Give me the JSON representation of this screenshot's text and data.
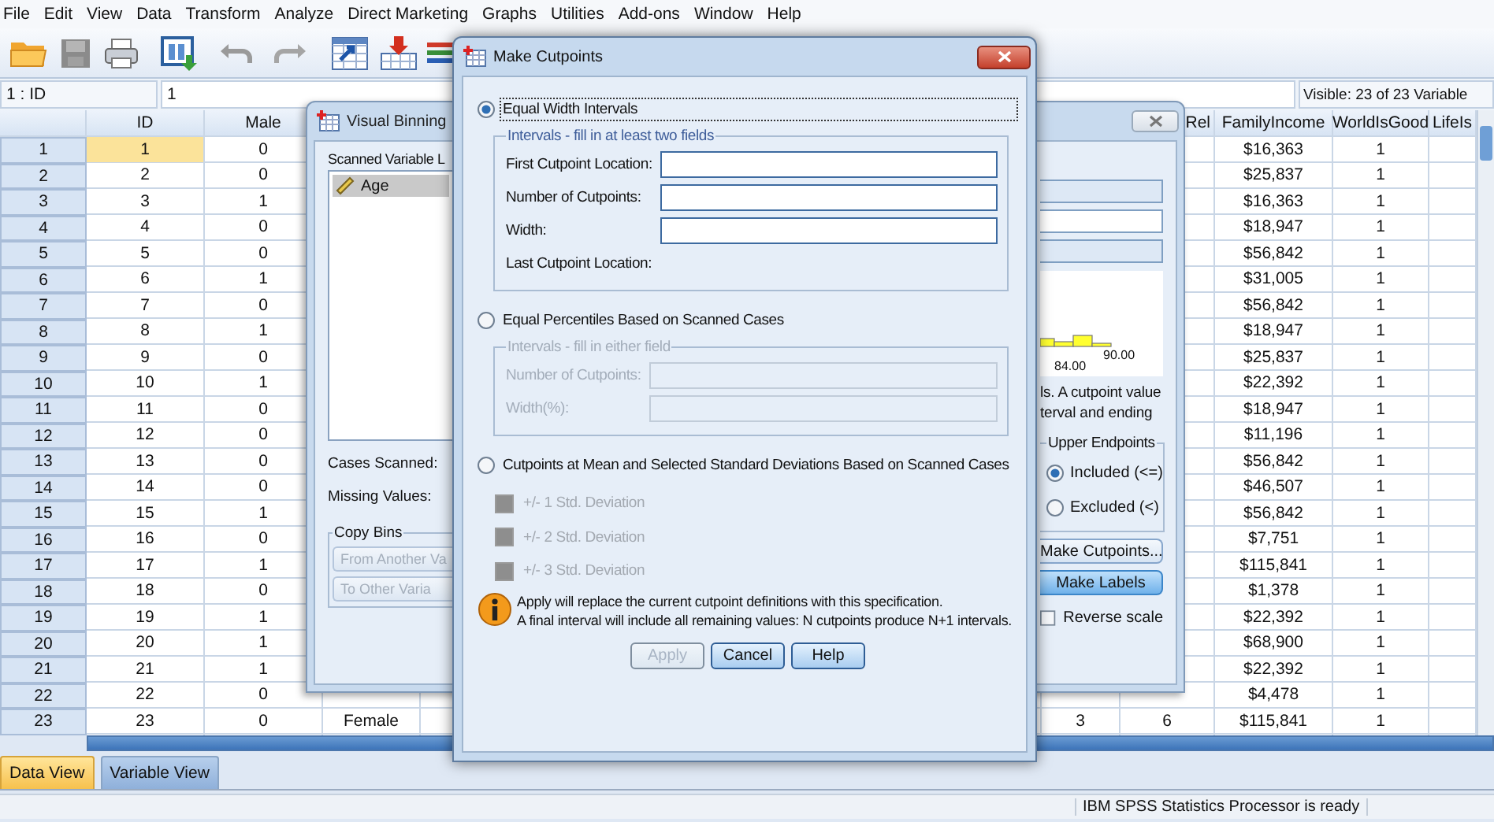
{
  "menu": [
    "File",
    "Edit",
    "View",
    "Data",
    "Transform",
    "Analyze",
    "Direct Marketing",
    "Graphs",
    "Utilities",
    "Add-ons",
    "Window",
    "Help"
  ],
  "cell_reference": {
    "name": "1 : ID",
    "value": "1"
  },
  "variables_visible": "Visible: 23 of 23 Variable",
  "grid": {
    "columns": [
      "ID",
      "Male",
      null,
      null,
      "Rel",
      "FamilyIncome",
      "WorldIsGood",
      "LifeIs"
    ],
    "rows": [
      {
        "number": "1",
        "cells": [
          {
            "text": "1",
            "active": true
          },
          {
            "text": "0",
            "active": false
          },
          null,
          null,
          null,
          {
            "text": "$16,363",
            "active": false
          },
          {
            "text": "1",
            "active": false
          },
          null
        ]
      },
      {
        "number": "2",
        "cells": [
          {
            "text": "2",
            "active": false
          },
          {
            "text": "0",
            "active": false
          },
          null,
          null,
          null,
          {
            "text": "$25,837",
            "active": false
          },
          {
            "text": "1",
            "active": false
          },
          null
        ]
      },
      {
        "number": "3",
        "cells": [
          {
            "text": "3",
            "active": false
          },
          {
            "text": "1",
            "active": false
          },
          null,
          null,
          null,
          {
            "text": "$16,363",
            "active": false
          },
          {
            "text": "1",
            "active": false
          },
          null
        ]
      },
      {
        "number": "4",
        "cells": [
          {
            "text": "4",
            "active": false
          },
          {
            "text": "0",
            "active": false
          },
          null,
          null,
          null,
          {
            "text": "$18,947",
            "active": false
          },
          {
            "text": "1",
            "active": false
          },
          null
        ]
      },
      {
        "number": "5",
        "cells": [
          {
            "text": "5",
            "active": false
          },
          {
            "text": "0",
            "active": false
          },
          null,
          null,
          null,
          {
            "text": "$56,842",
            "active": false
          },
          {
            "text": "1",
            "active": false
          },
          null
        ]
      },
      {
        "number": "6",
        "cells": [
          {
            "text": "6",
            "active": false
          },
          {
            "text": "1",
            "active": false
          },
          null,
          null,
          null,
          {
            "text": "$31,005",
            "active": false
          },
          {
            "text": "1",
            "active": false
          },
          null
        ]
      },
      {
        "number": "7",
        "cells": [
          {
            "text": "7",
            "active": false
          },
          {
            "text": "0",
            "active": false
          },
          null,
          null,
          null,
          {
            "text": "$56,842",
            "active": false
          },
          {
            "text": "1",
            "active": false
          },
          null
        ]
      },
      {
        "number": "8",
        "cells": [
          {
            "text": "8",
            "active": false
          },
          {
            "text": "1",
            "active": false
          },
          null,
          null,
          null,
          {
            "text": "$18,947",
            "active": false
          },
          {
            "text": "1",
            "active": false
          },
          null
        ]
      },
      {
        "number": "9",
        "cells": [
          {
            "text": "9",
            "active": false
          },
          {
            "text": "0",
            "active": false
          },
          null,
          null,
          null,
          {
            "text": "$25,837",
            "active": false
          },
          {
            "text": "1",
            "active": false
          },
          null
        ]
      },
      {
        "number": "10",
        "cells": [
          {
            "text": "10",
            "active": false
          },
          {
            "text": "1",
            "active": false
          },
          null,
          null,
          null,
          {
            "text": "$22,392",
            "active": false
          },
          {
            "text": "1",
            "active": false
          },
          null
        ]
      },
      {
        "number": "11",
        "cells": [
          {
            "text": "11",
            "active": false
          },
          {
            "text": "0",
            "active": false
          },
          null,
          null,
          null,
          {
            "text": "$18,947",
            "active": false
          },
          {
            "text": "1",
            "active": false
          },
          null
        ]
      },
      {
        "number": "12",
        "cells": [
          {
            "text": "12",
            "active": false
          },
          {
            "text": "0",
            "active": false
          },
          null,
          null,
          null,
          {
            "text": "$11,196",
            "active": false
          },
          {
            "text": "1",
            "active": false
          },
          null
        ]
      },
      {
        "number": "13",
        "cells": [
          {
            "text": "13",
            "active": false
          },
          {
            "text": "0",
            "active": false
          },
          null,
          null,
          null,
          {
            "text": "$56,842",
            "active": false
          },
          {
            "text": "1",
            "active": false
          },
          null
        ]
      },
      {
        "number": "14",
        "cells": [
          {
            "text": "14",
            "active": false
          },
          {
            "text": "0",
            "active": false
          },
          null,
          null,
          null,
          {
            "text": "$46,507",
            "active": false
          },
          {
            "text": "1",
            "active": false
          },
          null
        ]
      },
      {
        "number": "15",
        "cells": [
          {
            "text": "15",
            "active": false
          },
          {
            "text": "1",
            "active": false
          },
          null,
          null,
          null,
          {
            "text": "$56,842",
            "active": false
          },
          {
            "text": "1",
            "active": false
          },
          null
        ]
      },
      {
        "number": "16",
        "cells": [
          {
            "text": "16",
            "active": false
          },
          {
            "text": "0",
            "active": false
          },
          null,
          null,
          null,
          {
            "text": "$7,751",
            "active": false
          },
          {
            "text": "1",
            "active": false
          },
          null
        ]
      },
      {
        "number": "17",
        "cells": [
          {
            "text": "17",
            "active": false
          },
          {
            "text": "1",
            "active": false
          },
          null,
          null,
          null,
          {
            "text": "$115,841",
            "active": false
          },
          {
            "text": "1",
            "active": false
          },
          null
        ]
      },
      {
        "number": "18",
        "cells": [
          {
            "text": "18",
            "active": false
          },
          {
            "text": "0",
            "active": false
          },
          null,
          null,
          null,
          {
            "text": "$1,378",
            "active": false
          },
          {
            "text": "1",
            "active": false
          },
          null
        ]
      },
      {
        "number": "19",
        "cells": [
          {
            "text": "19",
            "active": false
          },
          {
            "text": "1",
            "active": false
          },
          null,
          null,
          null,
          {
            "text": "$22,392",
            "active": false
          },
          {
            "text": "1",
            "active": false
          },
          null
        ]
      },
      {
        "number": "20",
        "cells": [
          {
            "text": "20",
            "active": false
          },
          {
            "text": "1",
            "active": false
          },
          null,
          null,
          null,
          {
            "text": "$68,900",
            "active": false
          },
          {
            "text": "1",
            "active": false
          },
          null
        ]
      },
      {
        "number": "21",
        "cells": [
          {
            "text": "21",
            "active": false
          },
          {
            "text": "1",
            "active": false
          },
          null,
          null,
          null,
          {
            "text": "$22,392",
            "active": false
          },
          {
            "text": "1",
            "active": false
          },
          null
        ]
      },
      {
        "number": "22",
        "cells": [
          {
            "text": "22",
            "active": false
          },
          {
            "text": "0",
            "active": false
          },
          null,
          null,
          null,
          {
            "text": "$4,478",
            "active": false
          },
          {
            "text": "1",
            "active": false
          },
          null
        ]
      },
      {
        "number": "23",
        "cells": [
          {
            "text": "23",
            "active": false
          },
          {
            "text": "0",
            "active": false
          },
          {
            "text": "Female",
            "active": false
          },
          {
            "text": "3",
            "active": false
          },
          {
            "text": "6",
            "active": false
          },
          {
            "text": "$115,841",
            "active": false
          },
          {
            "text": "1",
            "active": false
          },
          null
        ]
      }
    ]
  },
  "view_tabs": [
    {
      "label": "Data View",
      "selected": true
    },
    {
      "label": "Variable View",
      "selected": false
    }
  ],
  "status_bar": {
    "message": "IBM SPSS Statistics Processor is ready"
  },
  "visual_binning": {
    "title": "Visual Binning",
    "scanned_variable_list_label": "Scanned Variable L",
    "variables": [
      {
        "name": "Age",
        "selected": true
      }
    ],
    "cases_scanned_label": "Cases Scanned:",
    "missing_values_label": "Missing Values:",
    "copy_bins": {
      "title": "Copy Bins",
      "buttons": [
        {
          "label": "From Another Va",
          "disabled": true
        },
        {
          "label": "To Other Varia",
          "disabled": true
        }
      ]
    },
    "fields": [
      {
        "disabled": true
      },
      {
        "disabled": false
      },
      {
        "disabled": true
      }
    ],
    "histogram": {
      "labels": [
        "84.00",
        "90.00"
      ]
    },
    "note_lines": [
      "ls. A cutpoint value",
      "terval and ending"
    ],
    "upper_endpoints": {
      "title": "Upper Endpoints",
      "options": [
        {
          "label": "Included (<=)",
          "selected": true
        },
        {
          "label": "Excluded (<)",
          "selected": false
        }
      ]
    },
    "buttons": [
      {
        "label": "Make Cutpoints...",
        "highlighted": false
      },
      {
        "label": "Make Labels",
        "highlighted": true
      }
    ],
    "reverse_scale": {
      "label": "Reverse scale",
      "checked": false
    }
  },
  "make_cutpoints": {
    "title": "Make Cutpoints",
    "methods": [
      {
        "label": "Equal Width Intervals",
        "selected": true,
        "focused": true,
        "group": {
          "title": "Intervals - fill in at least two fields",
          "disabled": false,
          "fields": [
            {
              "label": "First Cutpoint Location:",
              "kind": "input"
            },
            {
              "label": "Number of Cutpoints:",
              "kind": "input"
            },
            {
              "label": "Width:",
              "kind": "input"
            },
            {
              "label": "Last Cutpoint Location:",
              "kind": "readout"
            }
          ]
        }
      },
      {
        "label": "Equal Percentiles Based on Scanned Cases",
        "selected": false,
        "focused": false,
        "group": {
          "title": "Intervals - fill in either field",
          "disabled": true,
          "fields": [
            {
              "label": "Number of Cutpoints:",
              "kind": "input"
            },
            {
              "label": "Width(%):",
              "kind": "input"
            }
          ]
        }
      },
      {
        "label": "Cutpoints at Mean and Selected Standard Deviations Based on Scanned Cases",
        "selected": false,
        "focused": false,
        "options": [
          {
            "label": "+/- 1 Std. Deviation",
            "checked": false,
            "disabled": true
          },
          {
            "label": "+/- 2 Std. Deviation",
            "checked": false,
            "disabled": true
          },
          {
            "label": "+/- 3 Std. Deviation",
            "checked": false,
            "disabled": true
          }
        ]
      }
    ],
    "info": [
      "Apply will replace the current cutpoint definitions with this specification.",
      "A final interval will include all remaining values: N cutpoints produce N+1 intervals."
    ],
    "buttons": [
      {
        "label": "Apply",
        "disabled": true
      },
      {
        "label": "Cancel",
        "disabled": false
      },
      {
        "label": "Help",
        "disabled": false
      }
    ]
  }
}
